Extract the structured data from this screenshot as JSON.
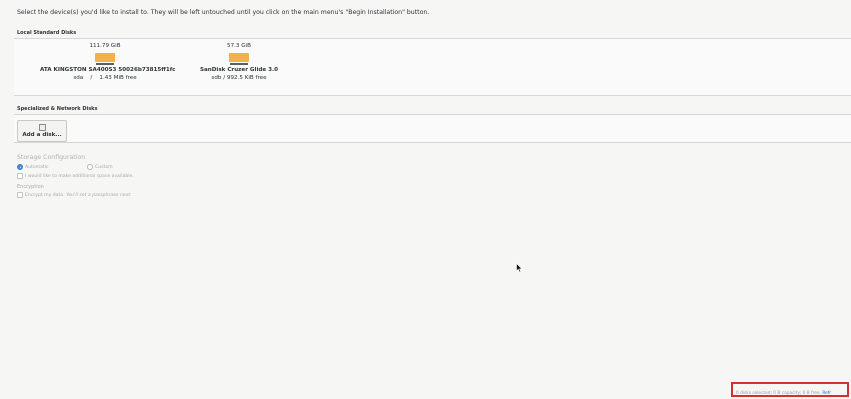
{
  "instructions": "Select the device(s) you'd like to install to.  They will be left untouched until you click on the main menu's \"Begin Installation\" button.",
  "local_disks": {
    "title": "Local Standard Disks",
    "disks": [
      {
        "size": "111.79 GiB",
        "name": "ATA KINGSTON SA400S3 50026b73815ff1fc",
        "device": "sda",
        "sep": "/",
        "free": "1.43 MiB free"
      },
      {
        "size": "57.3 GiB",
        "name": "SanDisk Cruzer Glide 3.0",
        "device": "sdb",
        "sep": "/",
        "free": "992.5 KiB free"
      }
    ]
  },
  "network_disks": {
    "title": "Specialized & Network Disks",
    "add_button": "Add a disk..."
  },
  "storage_config": {
    "title": "Storage Configuration",
    "automatic": "Automatic",
    "custom": "Custom",
    "extra_space": "I would like to make additional space available."
  },
  "encryption": {
    "title": "Encryption",
    "encrypt_label": "Encrypt my data.",
    "encrypt_note": "You'll set a passphrase next."
  },
  "status": {
    "summary": "0 disks selected; 0 B capacity; 0 B free.",
    "refresh": "Refr"
  },
  "colors": {
    "disk_icon": "#f6b04b",
    "accent": "#4a90d9",
    "highlight_box": "#d62f2f",
    "link": "#2a64c5"
  }
}
